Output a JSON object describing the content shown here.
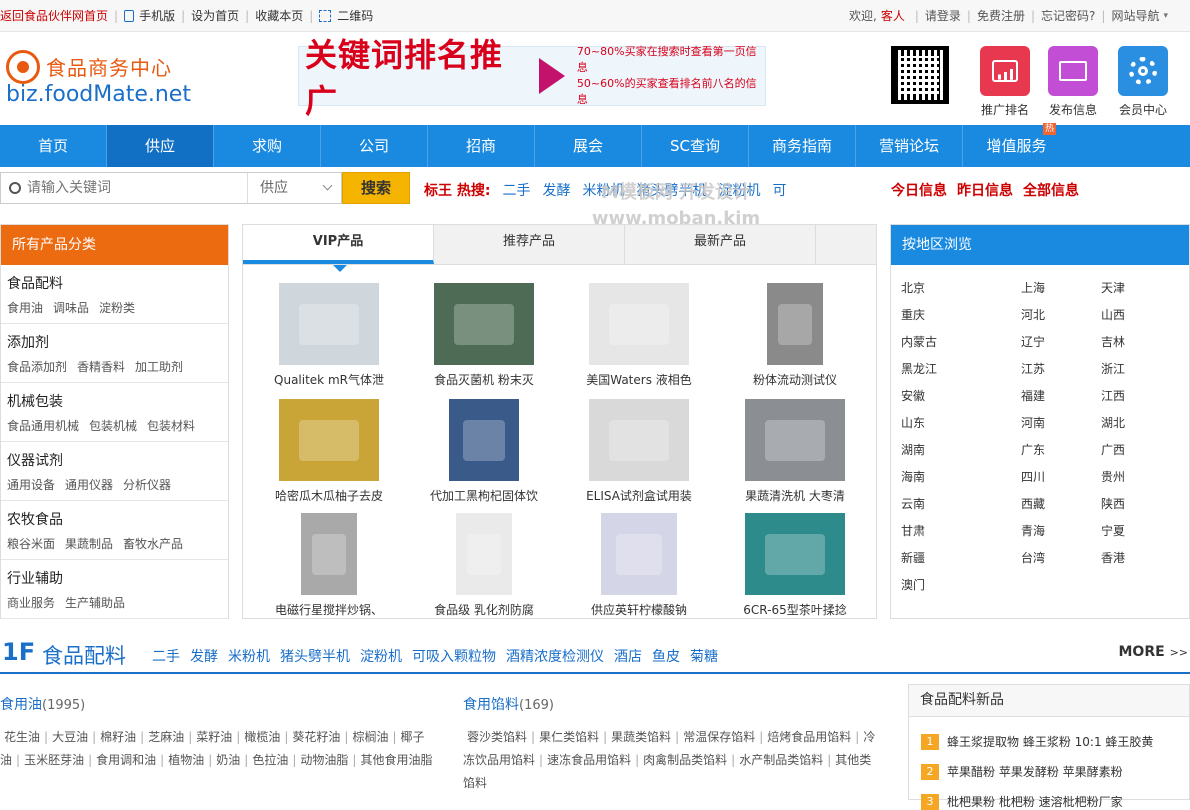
{
  "topbar": {
    "home_link": "返回食品伙伴网首页",
    "mobile": "手机版",
    "set_home": "设为首页",
    "bookmark": "收藏本页",
    "qrcode": "二维码",
    "welcome": "欢迎,",
    "guest": "客人",
    "login": "请登录",
    "register": "免费注册",
    "forgot": "忘记密码?",
    "site_nav": "网站导航"
  },
  "logo": {
    "cn": "食品商务中心",
    "en": "biz.foodMate.net"
  },
  "banner": {
    "title": "关键词排名推广",
    "line1": "70~80%买家在搜索时查看第一页信息",
    "line2": "50~60%的买家查看排名前八名的信息"
  },
  "services": [
    {
      "label": "推广排名",
      "color": "#e8384f"
    },
    {
      "label": "发布信息",
      "color": "#c34ed6"
    },
    {
      "label": "会员中心",
      "color": "#2a8fe0"
    }
  ],
  "nav": {
    "items": [
      "首页",
      "供应",
      "求购",
      "公司",
      "招商",
      "展会",
      "SC查询",
      "商务指南",
      "营销论坛",
      "增值服务"
    ],
    "hot_badge": "热"
  },
  "search": {
    "placeholder": "请输入关键词",
    "type": "供应",
    "button": "搜索",
    "hot_label": "标王 热搜:",
    "hot_keywords": [
      "二手",
      "发酵",
      "米粉机",
      "猪头劈半机",
      "淀粉机",
      "可"
    ]
  },
  "info_links": [
    "今日信息",
    "昨日信息",
    "全部信息"
  ],
  "category": {
    "header": "所有产品分类",
    "groups": [
      {
        "title": "食品配料",
        "subs": [
          "食用油",
          "调味品",
          "淀粉类"
        ]
      },
      {
        "title": "添加剂",
        "subs": [
          "食品添加剂",
          "香精香料",
          "加工助剂"
        ]
      },
      {
        "title": "机械包装",
        "subs": [
          "食品通用机械",
          "包装机械",
          "包装材料"
        ]
      },
      {
        "title": "仪器试剂",
        "subs": [
          "通用设备",
          "通用仪器",
          "分析仪器"
        ]
      },
      {
        "title": "农牧食品",
        "subs": [
          "粮谷米面",
          "果蔬制品",
          "畜牧水产品"
        ]
      },
      {
        "title": "行业辅助",
        "subs": [
          "商业服务",
          "生产辅助品"
        ]
      }
    ]
  },
  "products": {
    "tabs": [
      "VIP产品",
      "推荐产品",
      "最新产品"
    ],
    "items": [
      {
        "name": "Qualitek mR气体泄",
        "color": "#cfd6dc"
      },
      {
        "name": "食品灭菌机 粉末灭",
        "color": "#4d6b55"
      },
      {
        "name": "美国Waters 液相色",
        "color": "#e6e6e6"
      },
      {
        "name": "粉体流动测试仪",
        "color": "#8a8a8a"
      },
      {
        "name": "哈密瓜木瓜柚子去皮",
        "color": "#c9a437"
      },
      {
        "name": "代加工黑枸杞固体饮",
        "color": "#3a5a8a"
      },
      {
        "name": "ELISA试剂盒试用装",
        "color": "#d9d9d9"
      },
      {
        "name": "果蔬清洗机 大枣清",
        "color": "#8b8f94"
      },
      {
        "name": "电磁行星搅拌炒锅、",
        "color": "#a9a9a9"
      },
      {
        "name": "食品级 乳化剂防腐",
        "color": "#eaeaea"
      },
      {
        "name": "供应英轩柠檬酸钠",
        "color": "#d5d5e8"
      },
      {
        "name": "6CR-65型茶叶揉捻",
        "color": "#2e8b8b"
      }
    ]
  },
  "areas": {
    "header": "按地区浏览",
    "list": [
      "北京",
      "上海",
      "天津",
      "重庆",
      "河北",
      "山西",
      "内蒙古",
      "辽宁",
      "吉林",
      "黑龙江",
      "江苏",
      "浙江",
      "安徽",
      "福建",
      "江西",
      "山东",
      "河南",
      "湖北",
      "湖南",
      "广东",
      "广西",
      "海南",
      "四川",
      "贵州",
      "云南",
      "西藏",
      "陕西",
      "甘肃",
      "青海",
      "宁夏",
      "新疆",
      "台湾",
      "香港",
      "澳门"
    ]
  },
  "floor": {
    "num": "1F",
    "title": "食品配料",
    "tags": [
      "二手",
      "发酵",
      "米粉机",
      "猪头劈半机",
      "淀粉机",
      "可吸入颗粒物",
      "酒精浓度检测仪",
      "酒店",
      "鱼皮",
      "菊糖"
    ],
    "more": "MORE",
    "more_arrow": ">>",
    "col1": {
      "title": "食用油",
      "count": "(1995)",
      "items": [
        "花生油",
        "大豆油",
        "棉籽油",
        "芝麻油",
        "菜籽油",
        "橄榄油",
        "葵花籽油",
        "棕榈油",
        "椰子油",
        "玉米胚芽油",
        "食用调和油",
        "植物油",
        "奶油",
        "色拉油",
        "动物油脂",
        "其他食用油脂"
      ]
    },
    "col2": {
      "title": "食用馅料",
      "count": "(169)",
      "items": [
        "蓉沙类馅料",
        "果仁类馅料",
        "果蔬类馅料",
        "常温保存馅料",
        "焙烤食品用馅料",
        "冷冻饮品用馅料",
        "速冻食品用馅料",
        "肉禽制品类馅料",
        "水产制品类馅料",
        "其他类馅料"
      ]
    },
    "new": {
      "header": "食品配料新品",
      "items": [
        {
          "n": "1",
          "text": "蜂王浆提取物 蜂王浆粉 10:1 蜂王胶黄"
        },
        {
          "n": "2",
          "text": "苹果醋粉 苹果发酵粉 苹果酵素粉"
        },
        {
          "n": "3",
          "text": "枇杷果粉 枇杷粉 速溶枇杷粉厂家"
        }
      ]
    }
  },
  "watermark": {
    "line1": "M模板网 开发设计",
    "line2": "www.moban.kim"
  }
}
